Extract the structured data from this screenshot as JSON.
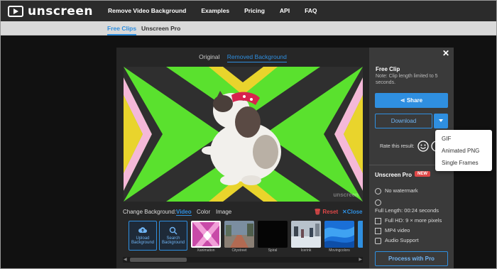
{
  "brand": {
    "name": "unscreen"
  },
  "nav": {
    "items": [
      "Remove Video Background",
      "Examples",
      "Pricing",
      "API",
      "FAQ"
    ]
  },
  "subnav": {
    "free": "Free Clips",
    "pro": "Unscreen Pro"
  },
  "view_toggle": {
    "original": "Original",
    "removed": "Removed Background"
  },
  "stage": {
    "watermark": "unscreen"
  },
  "background_bar": {
    "label": "Change Background:",
    "options": [
      "Video",
      "Color",
      "Image"
    ],
    "reset": "Reset",
    "close": "Close"
  },
  "thumbnails": {
    "upload": "Upload Background",
    "search": "Search Background",
    "items": [
      "Xanimation",
      "Citystreet",
      "Spiral",
      "Icerink",
      "Movingcolors"
    ]
  },
  "panel": {
    "title": "Free Clip",
    "note": "Note: Clip length limited to 5 seconds.",
    "share": "Share",
    "download": "Download",
    "rate": "Rate this result:",
    "pro_title": "Unscreen Pro",
    "new_badge": "NEW",
    "features": [
      "No watermark",
      "Full Length: 00:24 seconds",
      "Full HD: 9 × more pixels",
      "MP4 video",
      "Audio Support"
    ],
    "process": "Process with Pro"
  },
  "download_menu": [
    "GIF",
    "Animated PNG",
    "Single Frames"
  ],
  "colors": {
    "accent": "#2f8fe0",
    "danger": "#e04848",
    "green": "#5ae12e"
  }
}
